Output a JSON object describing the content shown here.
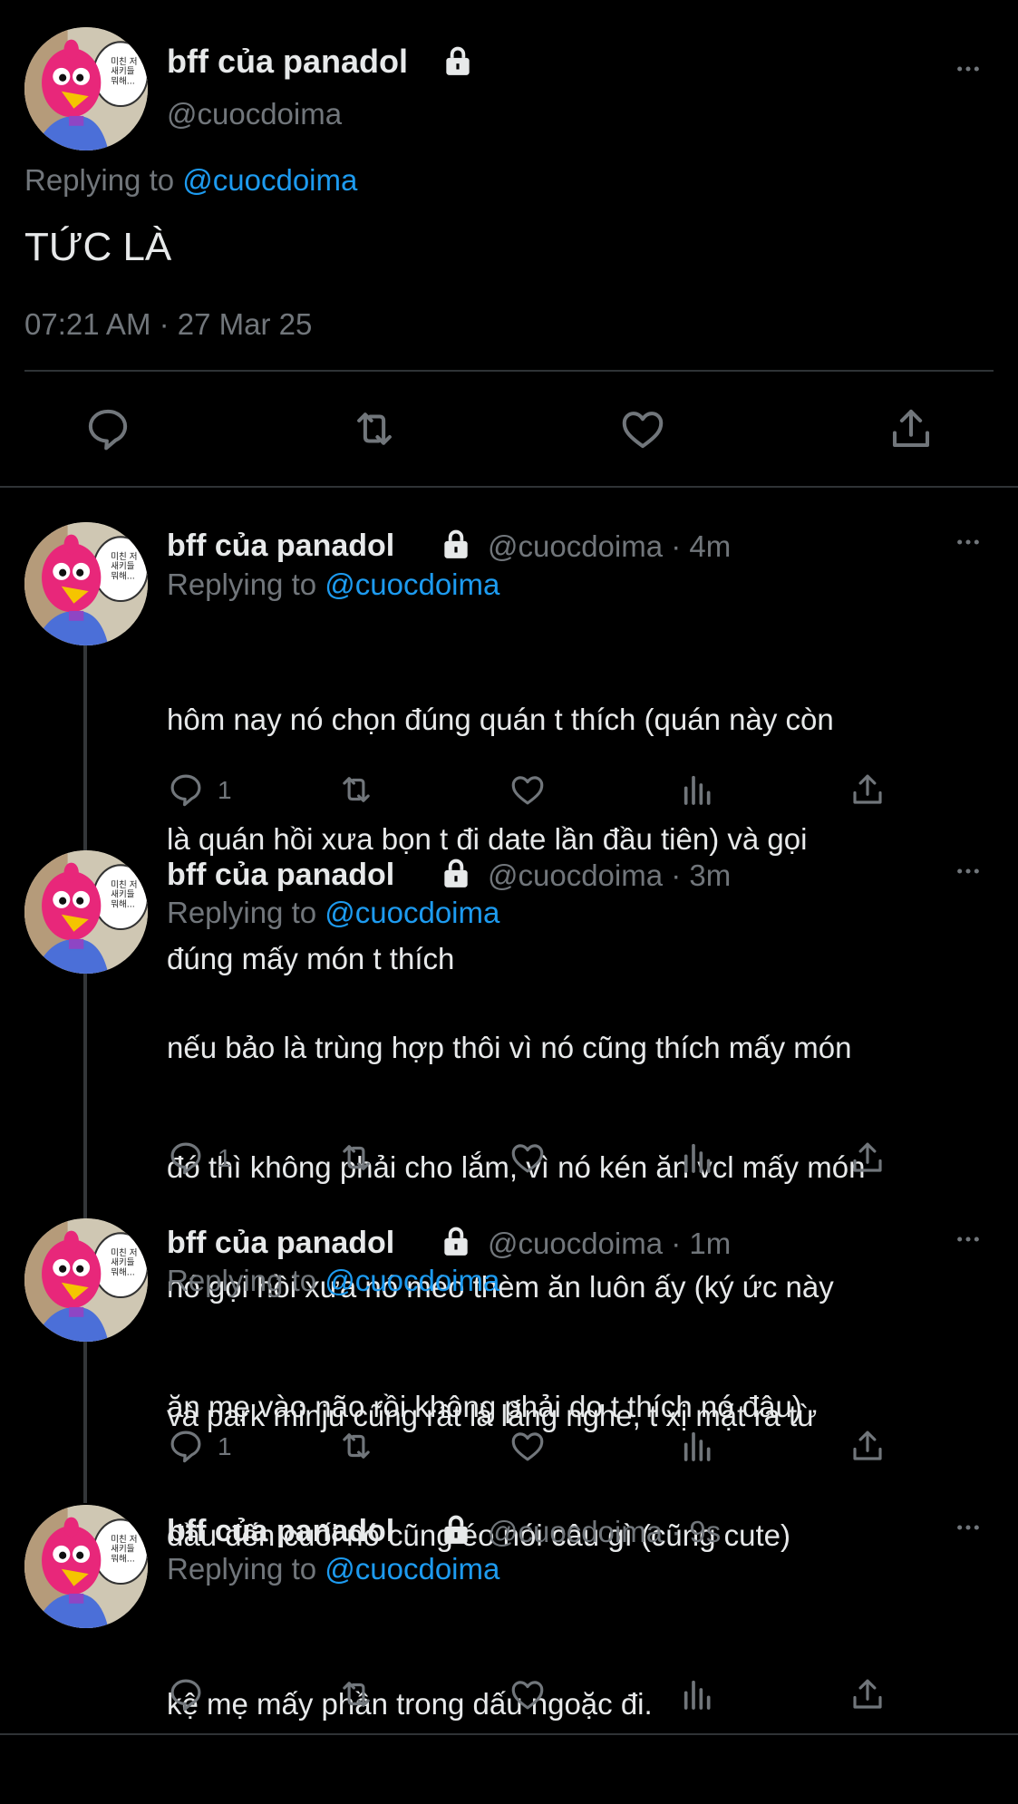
{
  "main_tweet": {
    "display_name": "bff của panadol",
    "handle": "@cuocdoima",
    "replying_prefix": "Replying to ",
    "replying_to": "@cuocdoima",
    "text": "TỨC LÀ",
    "timestamp": "07:21 AM · 27 Mar 25",
    "icons": [
      "lock-icon",
      "more-icon",
      "reply-icon",
      "retweet-icon",
      "like-icon",
      "share-icon"
    ]
  },
  "replies": [
    {
      "display_name": "bff của panadol",
      "handle_time": "@cuocdoima · 4m",
      "replying_prefix": "Replying to ",
      "replying_to": "@cuocdoima",
      "lines": [
        "hôm nay nó chọn đúng quán t thích (quán này còn",
        "là quán hồi xưa bọn t đi date lần đầu tiên) và gọi",
        "đúng mấy món t thích"
      ],
      "reply_count": "1"
    },
    {
      "display_name": "bff của panadol",
      "handle_time": "@cuocdoima · 3m",
      "replying_prefix": "Replying to ",
      "replying_to": "@cuocdoima",
      "lines": [
        "nếu bảo là trùng hợp thôi vì nó cũng thích mấy món",
        "đó thì không phải cho lắm, vì nó kén ăn vcl mấy món",
        "nó gọi hồi xưa nó méo thèm ăn luôn ấy (ký ức này",
        "ăn mẹ vào não rồi không phải do t thích nó đâu)"
      ],
      "reply_count": "1"
    },
    {
      "display_name": "bff của panadol",
      "handle_time": "@cuocdoima · 1m",
      "replying_prefix": "Replying to ",
      "replying_to": "@cuocdoima",
      "lines": [
        "và park minju cũng rất là lắng nghe, t xị mặt ra từ",
        "đầu đến cuối nó cũng éo nói câu gì (cũng cute)"
      ],
      "reply_count": "1"
    },
    {
      "display_name": "bff của panadol",
      "handle_time": "@cuocdoima · 9s",
      "replying_prefix": "Replying to ",
      "replying_to": "@cuocdoima",
      "lines": [
        "kệ mẹ mấy phần trong dấu ngoặc đi."
      ],
      "reply_count": ""
    }
  ],
  "colors": {
    "background": "#000000",
    "text": "#e7e9ea",
    "muted": "#71767b",
    "link": "#1d9bf0",
    "divider": "#2f3336"
  }
}
